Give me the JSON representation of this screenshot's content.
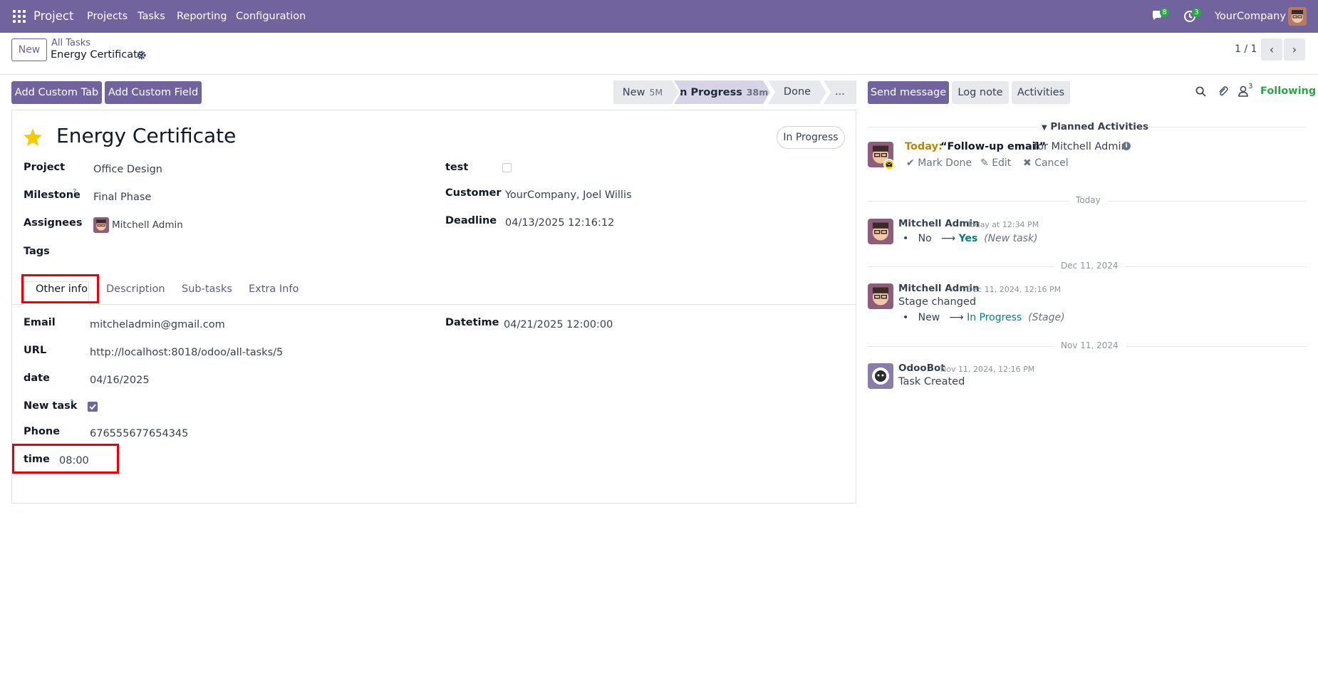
{
  "navbar": {
    "app_name": "Project",
    "menu": [
      "Projects",
      "Tasks",
      "Reporting",
      "Configuration"
    ],
    "messages_count": "8",
    "activities_count": "3",
    "company": "YourCompany"
  },
  "control_panel": {
    "new_label": "New",
    "breadcrumb_parent": "All Tasks",
    "breadcrumb_current": "Energy Certificate",
    "pager": "1 / 1"
  },
  "actions": {
    "add_custom_tab": "Add Custom Tab",
    "add_custom_field": "Add Custom Field"
  },
  "stages": [
    {
      "label": "New",
      "time": "5M"
    },
    {
      "label": "In Progress",
      "time": "38m"
    },
    {
      "label": "Done",
      "time": ""
    },
    {
      "label": "...",
      "time": ""
    }
  ],
  "form": {
    "title": "Energy Certificate",
    "state_badge": "In Progress",
    "fields_left": {
      "project_label": "Project",
      "project_value": "Office Design",
      "milestone_label": "Milestone",
      "milestone_value": "Final Phase",
      "assignees_label": "Assignees",
      "assignees_value": "Mitchell Admin",
      "tags_label": "Tags"
    },
    "fields_right": {
      "test_label": "test",
      "customer_label": "Customer",
      "customer_value": "YourCompany, Joel Willis",
      "deadline_label": "Deadline",
      "deadline_value": "04/13/2025 12:16:12"
    },
    "tabs": [
      "Other info",
      "Description",
      "Sub-tasks",
      "Extra Info"
    ],
    "other_info": {
      "email_label": "Email",
      "email_value": "mitcheladmin@gmail.com",
      "url_label": "URL",
      "url_value": "http://localhost:8018/odoo/all-tasks/5",
      "date_label": "date",
      "date_value": "04/16/2025",
      "new_task_label": "New task",
      "new_task_checked": true,
      "phone_label": "Phone",
      "phone_value": "676555677654345",
      "time_label": "time",
      "time_value": "08:00",
      "datetime_label": "Datetime",
      "datetime_value": "04/21/2025 12:00:00"
    },
    "help_mark": "?"
  },
  "chatter": {
    "send_message": "Send message",
    "log_note": "Log note",
    "activities": "Activities",
    "followers_count": "3",
    "following": "Following",
    "planned_title": "Planned Activities",
    "activity": {
      "when": "Today:",
      "summary": "“Follow-up email”",
      "for": "for Mitchell Admin",
      "mark_done": "Mark Done",
      "edit": "Edit",
      "cancel": "Cancel"
    },
    "separators": [
      "Today",
      "Dec 11, 2024",
      "Nov 11, 2024"
    ],
    "messages": [
      {
        "author": "Mitchell Admin",
        "date": "Today at 12:34 PM",
        "old": "No",
        "new": "Yes",
        "field": "(New task)"
      },
      {
        "author": "Mitchell Admin",
        "date": "Dec 11, 2024, 12:16 PM",
        "body": "Stage changed",
        "old": "New",
        "new": "In Progress",
        "field": "(Stage)"
      },
      {
        "author": "OdooBot",
        "date": "Nov 11, 2024, 12:16 PM",
        "body": "Task Created"
      }
    ]
  },
  "colors": {
    "brand": "#71639e",
    "link": "#017e84",
    "highlight": "#e8000d",
    "star": "#f3cc00",
    "following": "#28a745"
  }
}
